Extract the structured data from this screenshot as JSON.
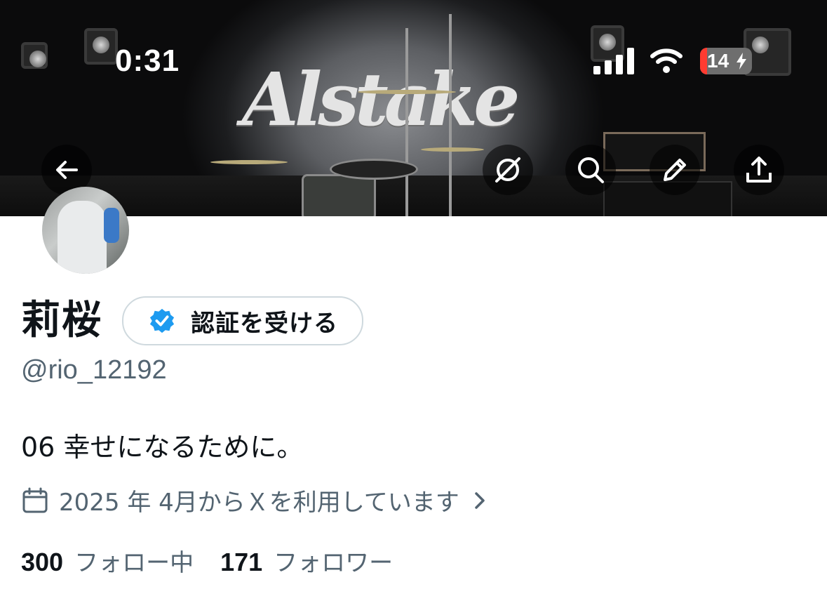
{
  "status_bar": {
    "time": "0:31",
    "battery": "14",
    "icons": [
      "cellular-signal-icon",
      "wifi-icon",
      "battery-charging-icon"
    ]
  },
  "header": {
    "banner_logo_text": "Alstake",
    "actions": [
      "back-arrow-icon",
      "grok-icon",
      "search-icon",
      "edit-pencil-icon",
      "share-icon"
    ]
  },
  "profile": {
    "display_name": "莉桜",
    "verify_button": "認証を受ける",
    "handle": "@rio_12192",
    "bio": "06 幸せになるために。",
    "joined": "2025 年 4月からＸを利用しています",
    "following_count": "300",
    "following_label": "フォロー中",
    "followers_count": "171",
    "followers_label": "フォロワー"
  },
  "colors": {
    "text_primary": "#0f1419",
    "text_secondary": "#536471",
    "verified_blue": "#1d9bf0",
    "button_border": "#cfd9de",
    "battery_low": "#ff3b30"
  }
}
